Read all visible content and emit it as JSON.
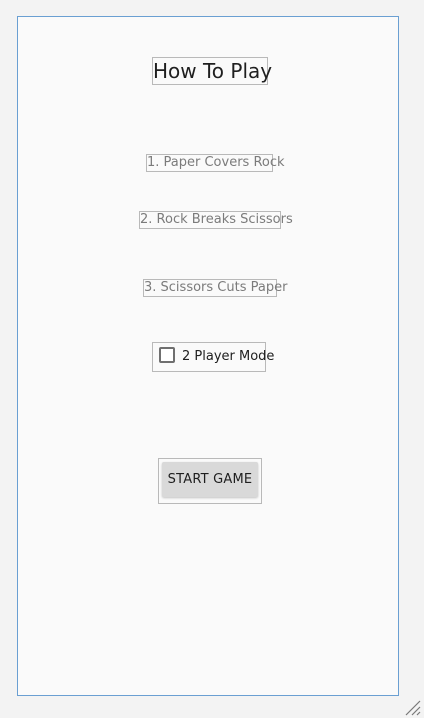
{
  "screen": {
    "title": "How To Play",
    "rules": [
      "1. Paper Covers Rock",
      "2. Rock Breaks Scissors",
      "3. Scissors Cuts Paper"
    ],
    "two_player_mode": {
      "label": "2 Player Mode",
      "checked": false
    },
    "start_button": "START GAME"
  },
  "colors": {
    "screen_border": "#6a9fd2",
    "background": "#fafafa",
    "button": "#d9d9d9"
  },
  "icons": {
    "resize": "resize-grip-icon"
  }
}
